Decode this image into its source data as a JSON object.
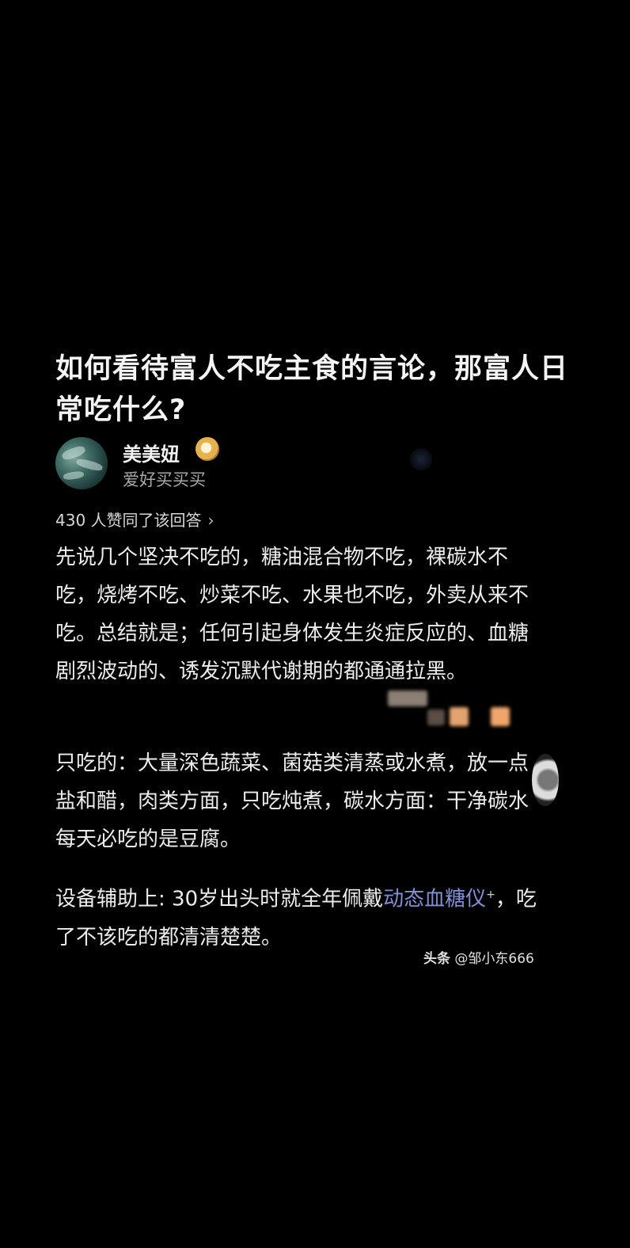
{
  "question": {
    "title": "如何看待富人不吃主食的言论，那富人日常吃什么?"
  },
  "answer": {
    "author_name": "美美妞",
    "author_bio": "爱好买买买",
    "likes_text": "430 人赞同了该回答",
    "likes_chevron": "›",
    "paragraph1": "先说几个坚决不吃的，糖油混合物不吃，裸碳水不吃，烧烤不吃、炒菜不吃、水果也不吃，外卖从来不吃。总结就是；任何引起身体发生炎症反应的、血糖剧烈波动的、诱发沉默代谢期的都通通拉黑。",
    "paragraph2": "只吃的：大量深色蔬菜、菌菇类清蒸或水煮，放一点盐和醋，肉类方面，只吃炖煮，碳水方面：干净碳水 每天必吃的是豆腐。",
    "paragraph3_before": "设备辅助上: 30岁出头时就全年佩戴",
    "paragraph3_link": "动态血糖仪",
    "paragraph3_sup": "+",
    "paragraph3_after": "，吃了不该吃的都清清楚楚。"
  },
  "watermark": {
    "brand": "头条",
    "handle": "@邹小东666"
  },
  "colors": {
    "background": "#000000",
    "link": "#7f8fd8",
    "badge": "#e6b24d"
  },
  "icons": [
    "avatar-image",
    "verified-badge-icon",
    "chevron-right-icon"
  ]
}
